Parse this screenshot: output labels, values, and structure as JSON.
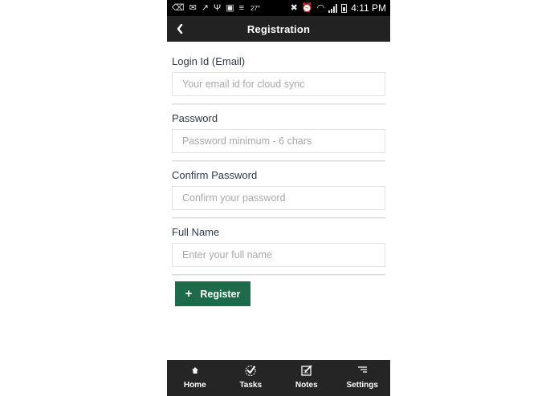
{
  "status_bar": {
    "temperature": "27°",
    "time": "4:11 PM"
  },
  "header": {
    "title": "Registration"
  },
  "form": {
    "fields": [
      {
        "label": "Login Id (Email)",
        "placeholder": "Your email id for cloud sync",
        "value": ""
      },
      {
        "label": "Password",
        "placeholder": "Password minimum - 6 chars",
        "value": ""
      },
      {
        "label": "Confirm Password",
        "placeholder": "Confirm your password",
        "value": ""
      },
      {
        "label": "Full Name",
        "placeholder": "Enter your full name",
        "value": ""
      }
    ],
    "submit_label": "Register"
  },
  "bottom_nav": {
    "items": [
      {
        "label": "Home",
        "icon": "home-icon"
      },
      {
        "label": "Tasks",
        "icon": "tasks-icon"
      },
      {
        "label": "Notes",
        "icon": "notes-icon"
      },
      {
        "label": "Settings",
        "icon": "settings-icon"
      }
    ]
  },
  "colors": {
    "header_bg": "#222222",
    "primary_button": "#1d6b4a",
    "nav_bg": "#252525",
    "label_text": "#2b3a4a"
  }
}
